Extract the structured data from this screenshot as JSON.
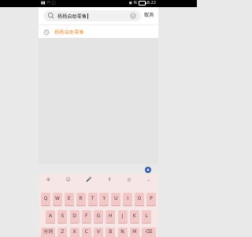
{
  "status_bar": {
    "left_icons": [
      "signal-icon",
      "wifi-icon",
      "hd-icon"
    ],
    "time": "8:22"
  },
  "search": {
    "query": "杨杨自助零售",
    "clear_label": "×",
    "cancel_label": "取消"
  },
  "suggestions": [
    {
      "icon": "clock-icon",
      "text": "杨杨自助零售"
    }
  ],
  "keyboard": {
    "toolbar": [
      "⊕",
      "☺",
      "🎤",
      "⇕",
      "◎",
      "⌄"
    ],
    "row1": [
      "Q",
      "W",
      "E",
      "R",
      "T",
      "Y",
      "U",
      "I",
      "O",
      "P"
    ],
    "row2": [
      "A",
      "S",
      "D",
      "F",
      "G",
      "H",
      "J",
      "K",
      "L"
    ],
    "row3": [
      "分词",
      "Z",
      "X",
      "C",
      "V",
      "B",
      "N",
      "M",
      "⌫"
    ]
  }
}
